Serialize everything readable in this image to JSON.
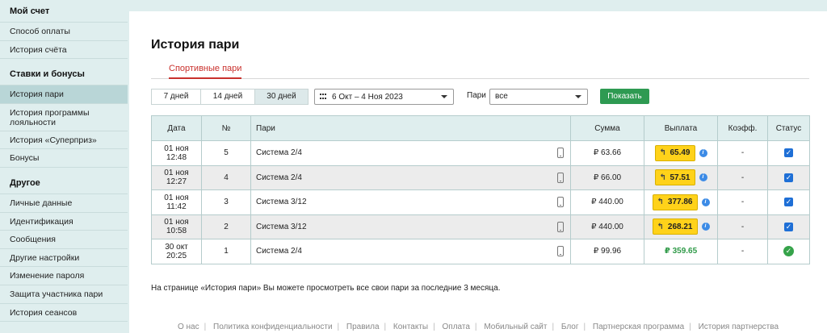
{
  "sidebar": {
    "sections": [
      {
        "title": "Мой счет",
        "items": [
          "Способ оплаты",
          "История счёта"
        ]
      },
      {
        "title": "Ставки и бонусы",
        "items": [
          "История пари",
          "История программы лояльности",
          "История «Суперприз»",
          "Бонусы"
        ]
      },
      {
        "title": "Другое",
        "items": [
          "Личные данные",
          "Идентификация",
          "Сообщения",
          "Другие настройки",
          "Изменение пароля",
          "Защита участника пари",
          "История сеансов"
        ]
      }
    ]
  },
  "page": {
    "title": "История пари",
    "tab": "Спортивные пари"
  },
  "filters": {
    "days": [
      "7 дней",
      "14 дней",
      "30 дней"
    ],
    "active_day": "30 дней",
    "date_range": "6 Окт – 4 Ноя 2023",
    "bets_label": "Пари",
    "bets_value": "все",
    "show_button": "Показать"
  },
  "table": {
    "headers": [
      "Дата",
      "№",
      "Пари",
      "Сумма",
      "Выплата",
      "Коэфф.",
      "Статус"
    ],
    "rows": [
      {
        "date": "01 ноя",
        "time": "12:48",
        "num": "5",
        "bet": "Система 2/4",
        "amount": "₽ 63.66",
        "payout": "65.49",
        "coef": "-",
        "status": "check"
      },
      {
        "date": "01 ноя",
        "time": "12:27",
        "num": "4",
        "bet": "Система 2/4",
        "amount": "₽ 66.00",
        "payout": "57.51",
        "coef": "-",
        "status": "check"
      },
      {
        "date": "01 ноя",
        "time": "11:42",
        "num": "3",
        "bet": "Система 3/12",
        "amount": "₽ 440.00",
        "payout": "377.86",
        "coef": "-",
        "status": "check"
      },
      {
        "date": "01 ноя",
        "time": "10:58",
        "num": "2",
        "bet": "Система 3/12",
        "amount": "₽ 440.00",
        "payout": "268.21",
        "coef": "-",
        "status": "check"
      },
      {
        "date": "30 окт",
        "time": "20:25",
        "num": "1",
        "bet": "Система 2/4",
        "amount": "₽ 99.96",
        "payout": "₽ 359.65",
        "coef": "-",
        "status": "won"
      }
    ]
  },
  "note": "На странице «История пари» Вы можете просмотреть все свои пари за последние 3 месяца.",
  "footer": [
    "О нас",
    "Политика конфиденциальности",
    "Правила",
    "Контакты",
    "Оплата",
    "Мобильный сайт",
    "Блог",
    "Партнерская программа",
    "История партнерства"
  ],
  "colors": {
    "accent": "#c9302c",
    "button": "#2e9a52",
    "payout": "#ffd21a",
    "sidebar": "#dfeeee"
  }
}
